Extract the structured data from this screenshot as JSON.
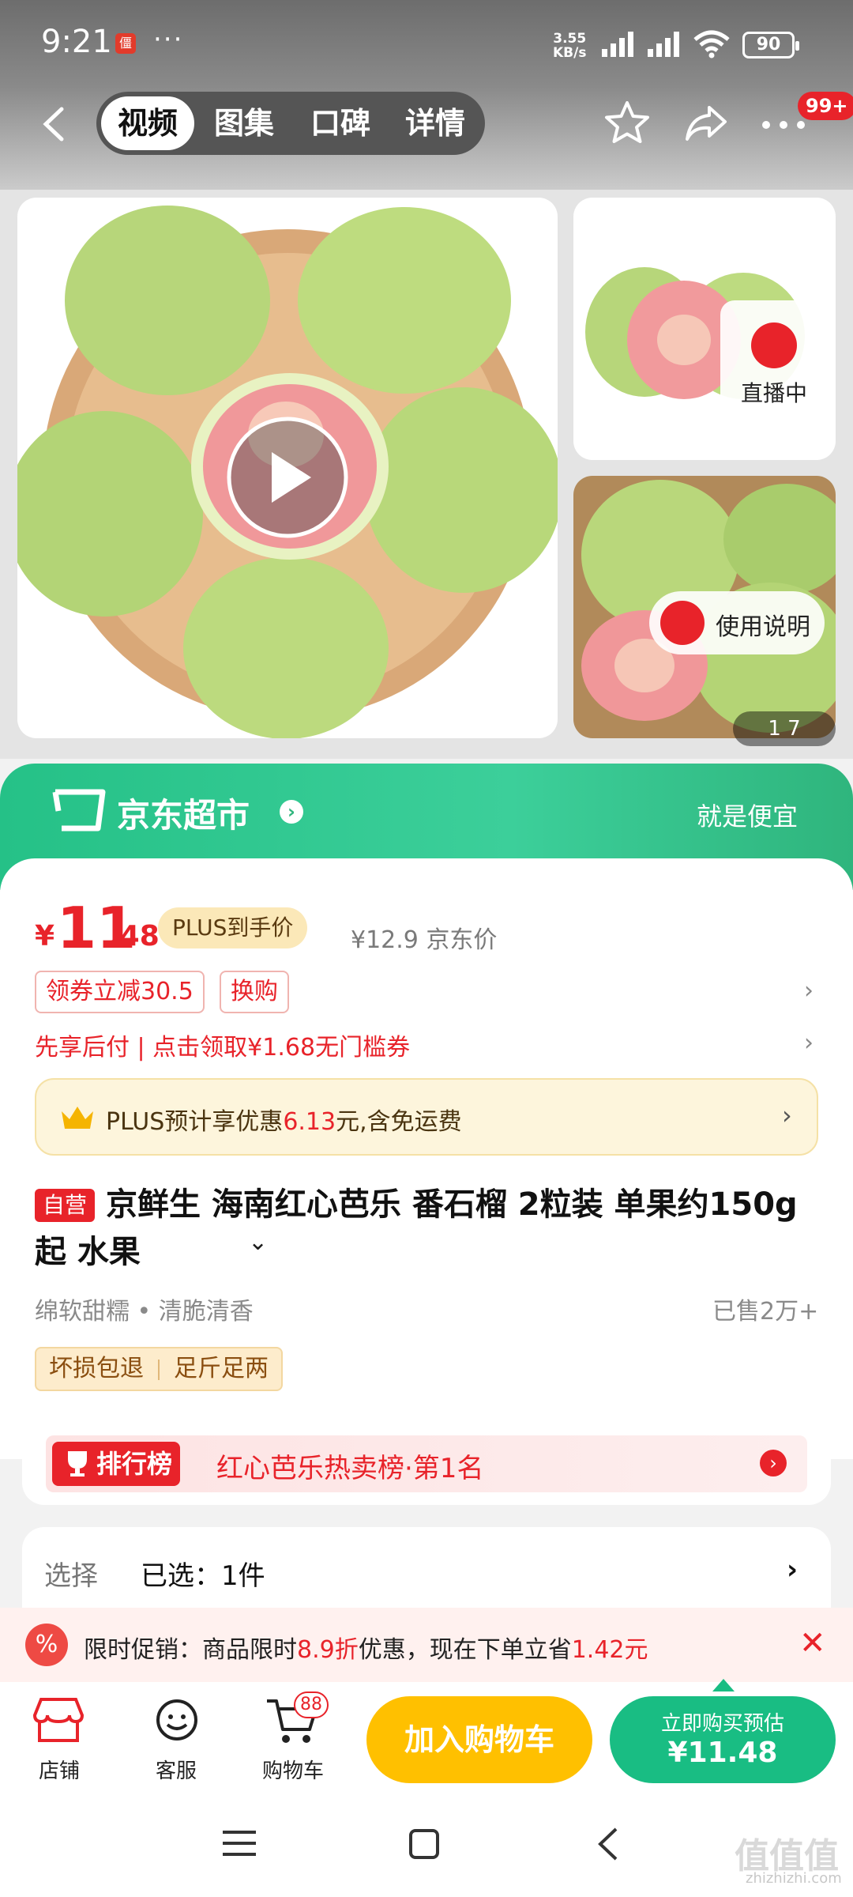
{
  "status_bar": {
    "time": "9:21",
    "app_badge": "僵",
    "dots": "···",
    "net_speed": "3.55",
    "net_unit": "KB/s",
    "battery": "90"
  },
  "nav": {
    "tabs": [
      {
        "label": "视频"
      },
      {
        "label": "图集"
      },
      {
        "label": "口碑"
      },
      {
        "label": "详情"
      }
    ],
    "more_badge": "99+"
  },
  "gallery": {
    "live_label": "直播中",
    "guide_label": "使用说明",
    "pager": "1  7"
  },
  "store": {
    "name": "京东超市",
    "slogan": "就是便宜"
  },
  "price": {
    "currency": "¥",
    "integer": "11",
    "decimal": ".48",
    "plus_tag": "PLUS到手价",
    "original": "¥12.9 京东价"
  },
  "coupons": [
    {
      "label": "领券立减30.5"
    },
    {
      "label": "换购"
    }
  ],
  "pay_later": "先享后付 | 点击领取¥1.68无门槛券",
  "plus_bar": {
    "text_a": "PLUS预计享优惠",
    "amount": "6.13",
    "text_b": "元,含免运费"
  },
  "product": {
    "self_tag": "自营",
    "title": "京鲜生 海南红心芭乐 番石榴 2粒装  单果约150g起  水果",
    "features": "绵软甜糯  •  清脆清香",
    "sold": "已售2万+",
    "services": [
      "坏损包退",
      "足斤足两"
    ]
  },
  "rank": {
    "tag": "排行榜",
    "text": "红心芭乐热卖榜·第1名"
  },
  "selection": {
    "label": "选择",
    "value": "已选：1件"
  },
  "promo": {
    "text_a": "限时促销：商品限时",
    "discount": "8.9折",
    "text_b": "优惠，现在下单立省",
    "save": "1.42元"
  },
  "bottom": {
    "shop": "店铺",
    "service": "客服",
    "cart": "购物车",
    "cart_count": "88",
    "add_cart": "加入购物车",
    "buy_l1": "立即购买预估",
    "buy_l2": "¥11.48"
  },
  "watermark": {
    "text": "值值值",
    "url": "zhizhizhi.com"
  },
  "colors": {
    "accent_red": "#e8232a",
    "jd_green": "#25c187",
    "cart_yellow": "#ffc000",
    "buy_green": "#19bd83"
  }
}
